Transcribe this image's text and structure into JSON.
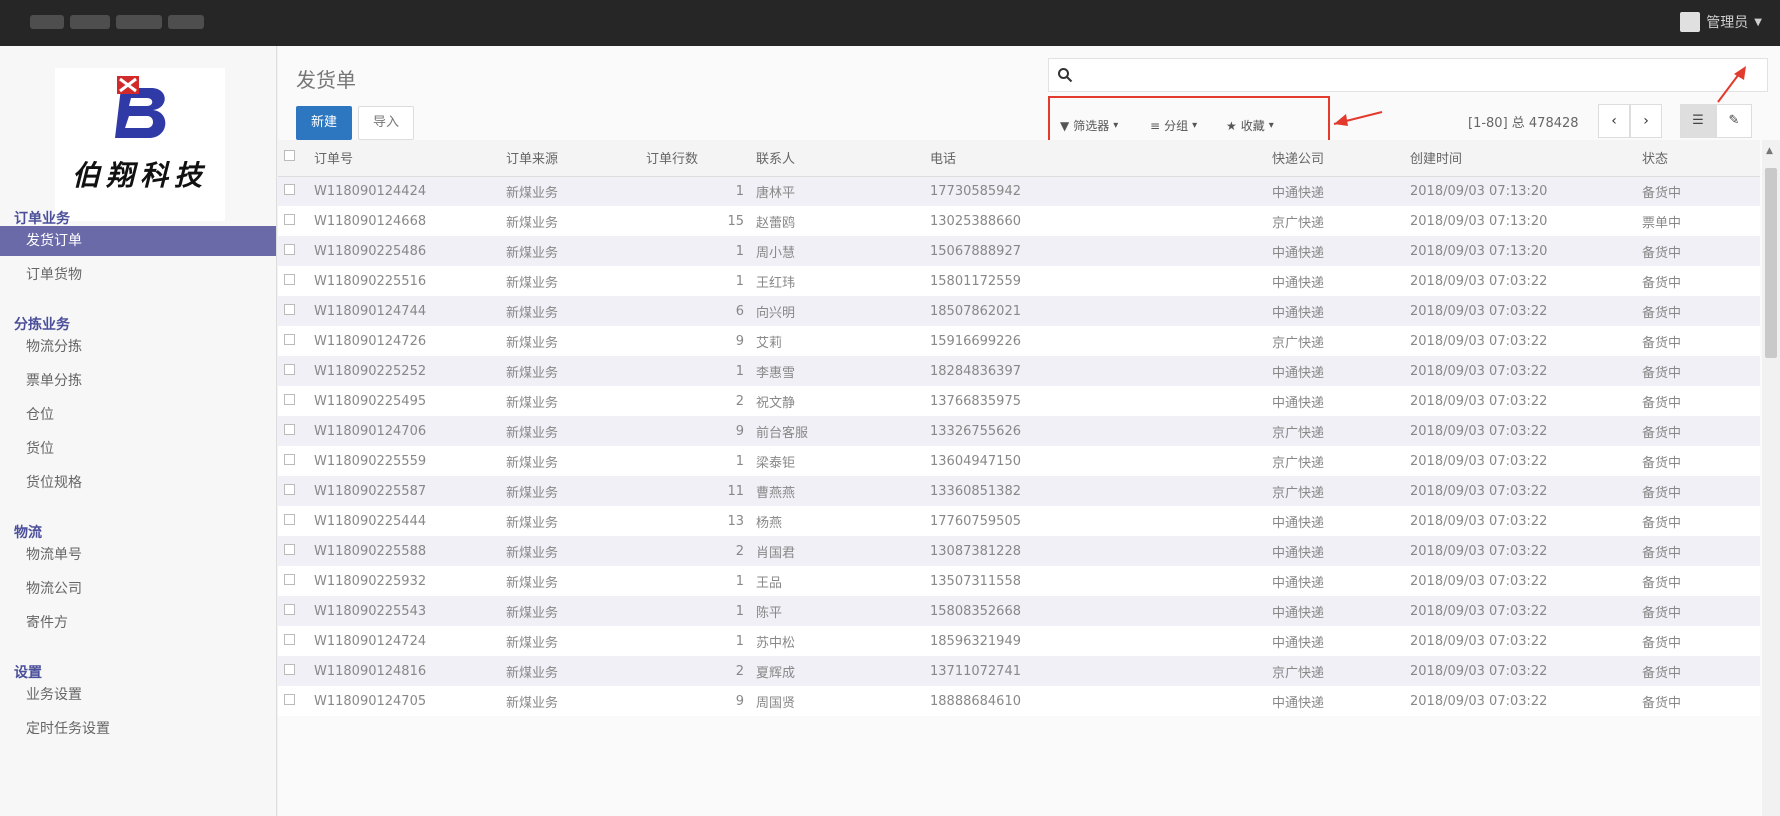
{
  "topbar": {
    "user_label": "管理员"
  },
  "logo": {
    "text": "伯翔科技"
  },
  "sidebar": {
    "sections": [
      {
        "title": "订单业务",
        "items": [
          {
            "label": "发货订单",
            "active": true
          },
          {
            "label": "订单货物"
          }
        ]
      },
      {
        "title": "分拣业务",
        "items": [
          {
            "label": "物流分拣"
          },
          {
            "label": "票单分拣"
          },
          {
            "label": "仓位"
          },
          {
            "label": "货位"
          },
          {
            "label": "货位规格"
          }
        ]
      },
      {
        "title": "物流",
        "items": [
          {
            "label": "物流单号"
          },
          {
            "label": "物流公司"
          },
          {
            "label": "寄件方"
          }
        ]
      },
      {
        "title": "设置",
        "items": [
          {
            "label": "业务设置"
          },
          {
            "label": "定时任务设置"
          }
        ]
      }
    ]
  },
  "main": {
    "title": "发货单",
    "new_label": "新建",
    "import_label": "导入",
    "filters": {
      "filter_label": "筛选器",
      "group_label": "分组",
      "favorite_label": "收藏"
    },
    "pager": {
      "text": "[1-80] 总 478428",
      "prev": "‹",
      "next": "›"
    },
    "columns": [
      "订单号",
      "订单来源",
      "订单行数",
      "联系人",
      "电话",
      "快递公司",
      "创建时间",
      "状态"
    ],
    "rows": [
      [
        "W118090124424",
        "新煤业务",
        "1",
        "唐林平",
        "17730585942",
        "中通快递",
        "2018/09/03 07:13:20",
        "备货中"
      ],
      [
        "W118090124668",
        "新煤业务",
        "15",
        "赵蕾鸥",
        "13025388660",
        "京广快递",
        "2018/09/03 07:13:20",
        "票单中"
      ],
      [
        "W118090225486",
        "新煤业务",
        "1",
        "周小慧",
        "15067888927",
        "中通快递",
        "2018/09/03 07:13:20",
        "备货中"
      ],
      [
        "W118090225516",
        "新煤业务",
        "1",
        "王红玮",
        "15801172559",
        "中通快递",
        "2018/09/03 07:03:22",
        "备货中"
      ],
      [
        "W118090124744",
        "新煤业务",
        "6",
        "向兴明",
        "18507862021",
        "中通快递",
        "2018/09/03 07:03:22",
        "备货中"
      ],
      [
        "W118090124726",
        "新煤业务",
        "9",
        "艾莉",
        "15916699226",
        "京广快递",
        "2018/09/03 07:03:22",
        "备货中"
      ],
      [
        "W118090225252",
        "新煤业务",
        "1",
        "李惠雪",
        "18284836397",
        "中通快递",
        "2018/09/03 07:03:22",
        "备货中"
      ],
      [
        "W118090225495",
        "新煤业务",
        "2",
        "祝文静",
        "13766835975",
        "中通快递",
        "2018/09/03 07:03:22",
        "备货中"
      ],
      [
        "W118090124706",
        "新煤业务",
        "9",
        "前台客服",
        "13326755626",
        "京广快递",
        "2018/09/03 07:03:22",
        "备货中"
      ],
      [
        "W118090225559",
        "新煤业务",
        "1",
        "梁泰钜",
        "13604947150",
        "京广快递",
        "2018/09/03 07:03:22",
        "备货中"
      ],
      [
        "W118090225587",
        "新煤业务",
        "11",
        "曹燕燕",
        "13360851382",
        "京广快递",
        "2018/09/03 07:03:22",
        "备货中"
      ],
      [
        "W118090225444",
        "新煤业务",
        "13",
        "杨燕",
        "17760759505",
        "中通快递",
        "2018/09/03 07:03:22",
        "备货中"
      ],
      [
        "W118090225588",
        "新煤业务",
        "2",
        "肖国君",
        "13087381228",
        "中通快递",
        "2018/09/03 07:03:22",
        "备货中"
      ],
      [
        "W118090225932",
        "新煤业务",
        "1",
        "王品",
        "13507311558",
        "中通快递",
        "2018/09/03 07:03:22",
        "备货中"
      ],
      [
        "W118090225543",
        "新煤业务",
        "1",
        "陈平",
        "15808352668",
        "中通快递",
        "2018/09/03 07:03:22",
        "备货中"
      ],
      [
        "W118090124724",
        "新煤业务",
        "1",
        "苏中松",
        "18596321949",
        "中通快递",
        "2018/09/03 07:03:22",
        "备货中"
      ],
      [
        "W118090124816",
        "新煤业务",
        "2",
        "夏辉成",
        "13711072741",
        "京广快递",
        "2018/09/03 07:03:22",
        "备货中"
      ],
      [
        "W118090124705",
        "新煤业务",
        "9",
        "周国贤",
        "18888684610",
        "中通快递",
        "2018/09/03 07:03:22",
        "备货中"
      ]
    ]
  },
  "colors": {
    "active_nav": "#6b6aa8",
    "primary_button": "#2d77c0",
    "highlight_box": "#e23b2e",
    "topbar": "#262626"
  }
}
